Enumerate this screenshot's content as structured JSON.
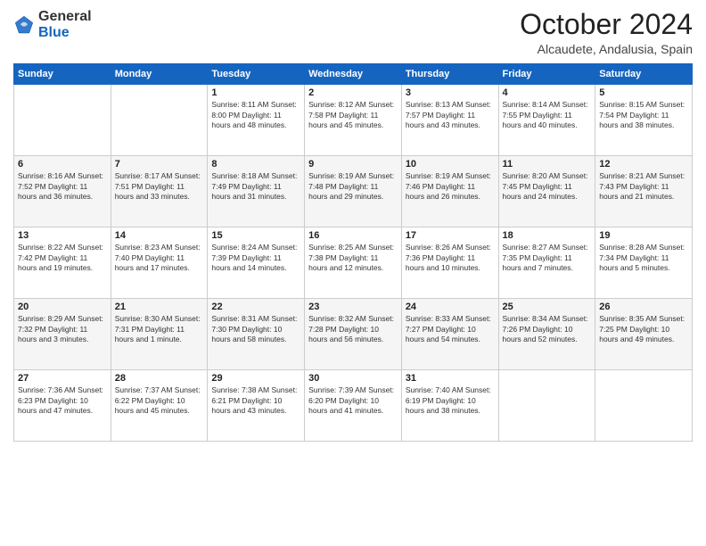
{
  "header": {
    "logo_general": "General",
    "logo_blue": "Blue",
    "month_title": "October 2024",
    "location": "Alcaudete, Andalusia, Spain"
  },
  "columns": [
    "Sunday",
    "Monday",
    "Tuesday",
    "Wednesday",
    "Thursday",
    "Friday",
    "Saturday"
  ],
  "weeks": [
    [
      {
        "day": "",
        "info": ""
      },
      {
        "day": "",
        "info": ""
      },
      {
        "day": "1",
        "info": "Sunrise: 8:11 AM\nSunset: 8:00 PM\nDaylight: 11 hours and 48 minutes."
      },
      {
        "day": "2",
        "info": "Sunrise: 8:12 AM\nSunset: 7:58 PM\nDaylight: 11 hours and 45 minutes."
      },
      {
        "day": "3",
        "info": "Sunrise: 8:13 AM\nSunset: 7:57 PM\nDaylight: 11 hours and 43 minutes."
      },
      {
        "day": "4",
        "info": "Sunrise: 8:14 AM\nSunset: 7:55 PM\nDaylight: 11 hours and 40 minutes."
      },
      {
        "day": "5",
        "info": "Sunrise: 8:15 AM\nSunset: 7:54 PM\nDaylight: 11 hours and 38 minutes."
      }
    ],
    [
      {
        "day": "6",
        "info": "Sunrise: 8:16 AM\nSunset: 7:52 PM\nDaylight: 11 hours and 36 minutes."
      },
      {
        "day": "7",
        "info": "Sunrise: 8:17 AM\nSunset: 7:51 PM\nDaylight: 11 hours and 33 minutes."
      },
      {
        "day": "8",
        "info": "Sunrise: 8:18 AM\nSunset: 7:49 PM\nDaylight: 11 hours and 31 minutes."
      },
      {
        "day": "9",
        "info": "Sunrise: 8:19 AM\nSunset: 7:48 PM\nDaylight: 11 hours and 29 minutes."
      },
      {
        "day": "10",
        "info": "Sunrise: 8:19 AM\nSunset: 7:46 PM\nDaylight: 11 hours and 26 minutes."
      },
      {
        "day": "11",
        "info": "Sunrise: 8:20 AM\nSunset: 7:45 PM\nDaylight: 11 hours and 24 minutes."
      },
      {
        "day": "12",
        "info": "Sunrise: 8:21 AM\nSunset: 7:43 PM\nDaylight: 11 hours and 21 minutes."
      }
    ],
    [
      {
        "day": "13",
        "info": "Sunrise: 8:22 AM\nSunset: 7:42 PM\nDaylight: 11 hours and 19 minutes."
      },
      {
        "day": "14",
        "info": "Sunrise: 8:23 AM\nSunset: 7:40 PM\nDaylight: 11 hours and 17 minutes."
      },
      {
        "day": "15",
        "info": "Sunrise: 8:24 AM\nSunset: 7:39 PM\nDaylight: 11 hours and 14 minutes."
      },
      {
        "day": "16",
        "info": "Sunrise: 8:25 AM\nSunset: 7:38 PM\nDaylight: 11 hours and 12 minutes."
      },
      {
        "day": "17",
        "info": "Sunrise: 8:26 AM\nSunset: 7:36 PM\nDaylight: 11 hours and 10 minutes."
      },
      {
        "day": "18",
        "info": "Sunrise: 8:27 AM\nSunset: 7:35 PM\nDaylight: 11 hours and 7 minutes."
      },
      {
        "day": "19",
        "info": "Sunrise: 8:28 AM\nSunset: 7:34 PM\nDaylight: 11 hours and 5 minutes."
      }
    ],
    [
      {
        "day": "20",
        "info": "Sunrise: 8:29 AM\nSunset: 7:32 PM\nDaylight: 11 hours and 3 minutes."
      },
      {
        "day": "21",
        "info": "Sunrise: 8:30 AM\nSunset: 7:31 PM\nDaylight: 11 hours and 1 minute."
      },
      {
        "day": "22",
        "info": "Sunrise: 8:31 AM\nSunset: 7:30 PM\nDaylight: 10 hours and 58 minutes."
      },
      {
        "day": "23",
        "info": "Sunrise: 8:32 AM\nSunset: 7:28 PM\nDaylight: 10 hours and 56 minutes."
      },
      {
        "day": "24",
        "info": "Sunrise: 8:33 AM\nSunset: 7:27 PM\nDaylight: 10 hours and 54 minutes."
      },
      {
        "day": "25",
        "info": "Sunrise: 8:34 AM\nSunset: 7:26 PM\nDaylight: 10 hours and 52 minutes."
      },
      {
        "day": "26",
        "info": "Sunrise: 8:35 AM\nSunset: 7:25 PM\nDaylight: 10 hours and 49 minutes."
      }
    ],
    [
      {
        "day": "27",
        "info": "Sunrise: 7:36 AM\nSunset: 6:23 PM\nDaylight: 10 hours and 47 minutes."
      },
      {
        "day": "28",
        "info": "Sunrise: 7:37 AM\nSunset: 6:22 PM\nDaylight: 10 hours and 45 minutes."
      },
      {
        "day": "29",
        "info": "Sunrise: 7:38 AM\nSunset: 6:21 PM\nDaylight: 10 hours and 43 minutes."
      },
      {
        "day": "30",
        "info": "Sunrise: 7:39 AM\nSunset: 6:20 PM\nDaylight: 10 hours and 41 minutes."
      },
      {
        "day": "31",
        "info": "Sunrise: 7:40 AM\nSunset: 6:19 PM\nDaylight: 10 hours and 38 minutes."
      },
      {
        "day": "",
        "info": ""
      },
      {
        "day": "",
        "info": ""
      }
    ]
  ]
}
